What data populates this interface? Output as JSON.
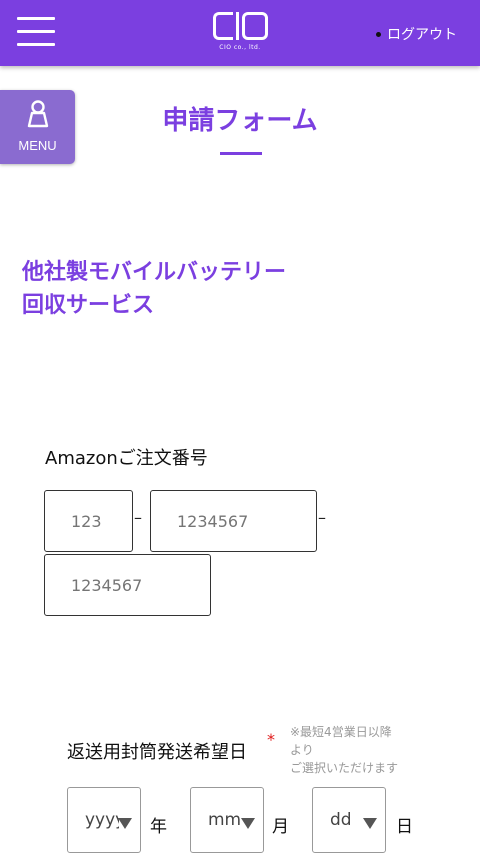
{
  "header": {
    "logo_text": "CIO",
    "logo_sub": "CIO co., ltd.",
    "logout_label": "ログアウト"
  },
  "menu": {
    "label": "MENU"
  },
  "page_title": "申請フォーム",
  "service_title": [
    "他社製モバイルバッテリー",
    "回収サービス"
  ],
  "amazon": {
    "label": "Amazonご注文番号",
    "part1_placeholder": "123",
    "part2_placeholder": "1234567",
    "part3_placeholder": "1234567",
    "separator": "–"
  },
  "return_date": {
    "label": "返送用封筒発送希望日",
    "required_mark": "*",
    "note": [
      "※最短4営業日以降",
      "より",
      "ご選択いただけます"
    ],
    "year_value": "yyyy",
    "year_unit": "年",
    "month_value": "mm",
    "month_unit": "月",
    "day_value": "dd",
    "day_unit": "日"
  },
  "colors": {
    "accent": "#7b3fe0",
    "menu": "#8a6bd0",
    "required": "#e01a1a"
  }
}
